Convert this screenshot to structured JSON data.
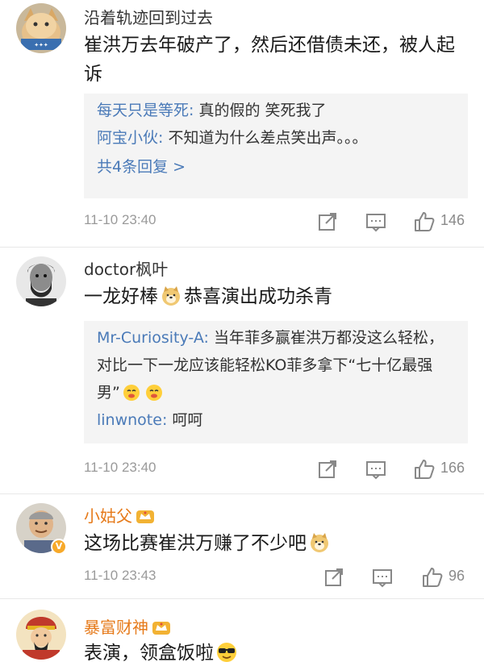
{
  "comments": [
    {
      "username": "沿着轨迹回到过去",
      "text": "崔洪万去年破产了，然后还借债未还，被人起诉",
      "avatar_icon": "cat-avatar",
      "replies": [
        {
          "name": "每天只是等死:",
          "text": " 真的假的  笑死我了"
        },
        {
          "name": "阿宝小伙:",
          "text": " 不知道为什么差点笑出声。。。"
        }
      ],
      "more_replies": "共4条回复 >",
      "time": "11-10 23:40",
      "likes": "146"
    },
    {
      "username": "doctor枫叶",
      "text_before_emoji": "一龙好棒",
      "text_after_emoji": "恭喜演出成功杀青",
      "avatar_icon": "bearded-man-avatar",
      "replies": [
        {
          "name": "Mr-Curiosity-A:",
          "text": " 当年菲多赢崔洪万都没这么轻松，对比一下一龙应该能轻松KO菲多拿下“七十亿最强男”"
        },
        {
          "name": "linwnote:",
          "text": " 呵呵"
        }
      ],
      "time": "11-10 23:40",
      "likes": "166"
    },
    {
      "username": "小姑父",
      "text": "这场比赛崔洪万赚了不少吧",
      "avatar_icon": "old-man-avatar",
      "badge": "V",
      "time": "11-10 23:43",
      "likes": "96"
    },
    {
      "username": "暴富财神",
      "text": "表演，领盒饭啦",
      "avatar_icon": "god-of-wealth-avatar"
    }
  ],
  "colors": {
    "link_blue": "#4a7ab8",
    "vip_orange": "#e67a1a",
    "meta_gray": "#9a9a9a",
    "reply_bg": "#f4f4f4"
  }
}
